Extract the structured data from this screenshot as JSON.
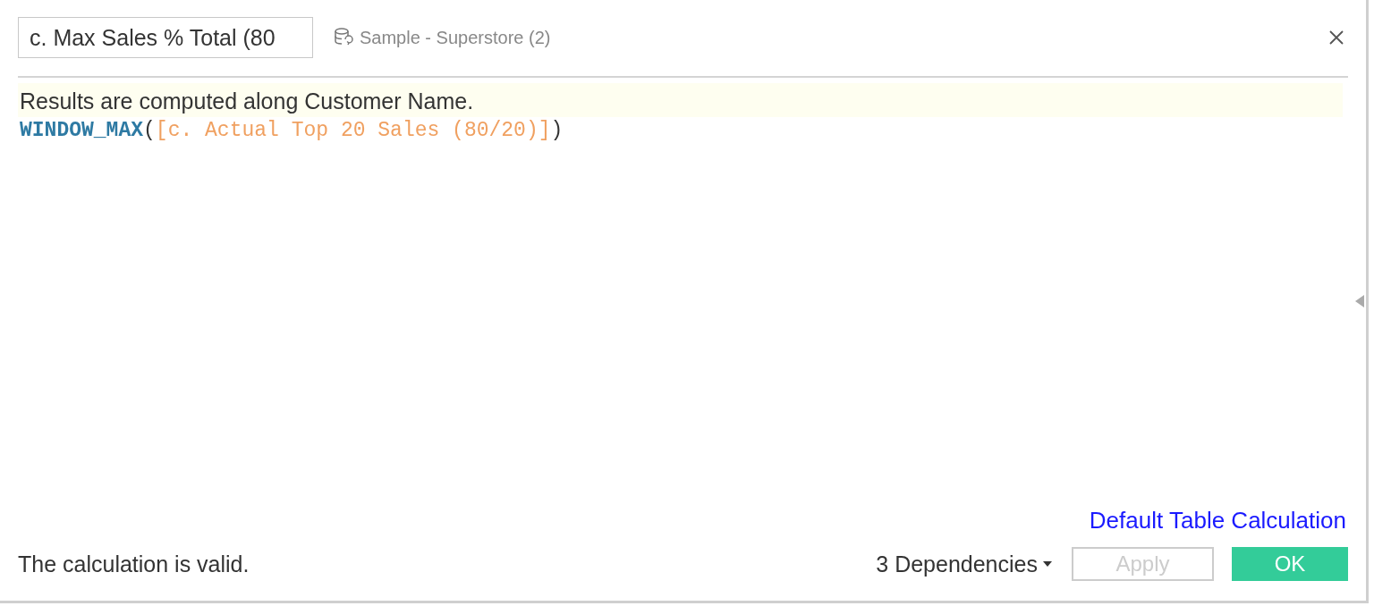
{
  "calc_name": {
    "value": "c. Max Sales % Total (80"
  },
  "data_source": "Sample - Superstore (2)",
  "info_banner": "Results are computed along Customer Name.",
  "formula": [
    {
      "kind": "function",
      "text": "WINDOW_MAX"
    },
    {
      "kind": "punct",
      "text": "("
    },
    {
      "kind": "field",
      "text": "[c. Actual Top 20 Sales (80/20)]"
    },
    {
      "kind": "punct",
      "text": ")"
    }
  ],
  "default_link": "Default Table Calculation",
  "status": "The calculation is valid.",
  "dependencies": "3 Dependencies",
  "buttons": [
    {
      "label": "Apply",
      "kind": "secondary",
      "disabled": true
    },
    {
      "label": "OK",
      "kind": "primary",
      "disabled": false
    }
  ]
}
